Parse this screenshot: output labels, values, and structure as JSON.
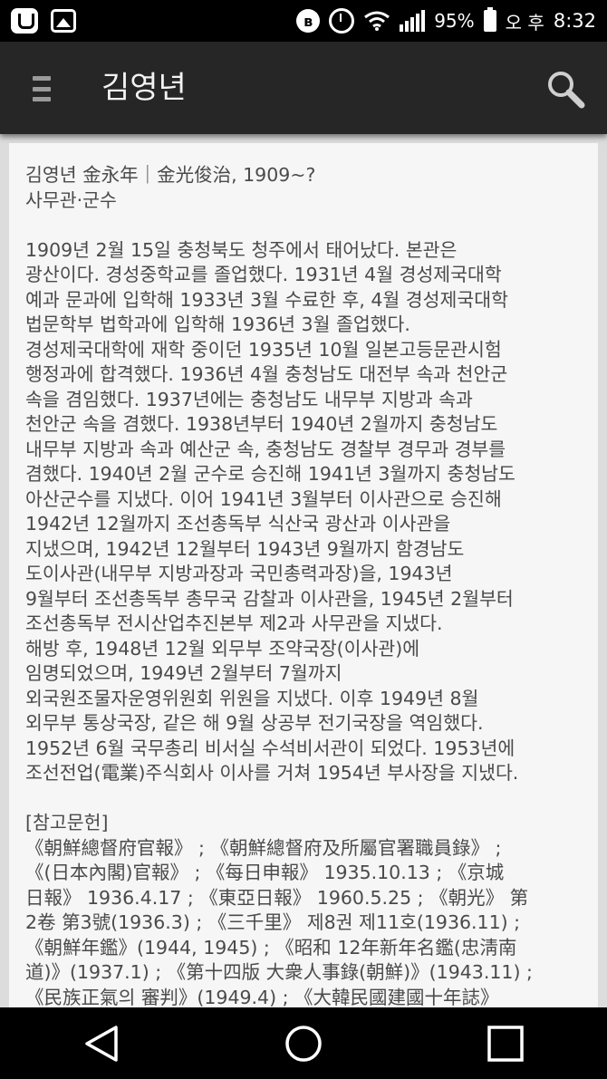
{
  "status_bar": {
    "battery": "95%",
    "ampm": "오 후",
    "time": "8:32",
    "icons": [
      "app-icon",
      "gallery-icon",
      "bluetooth-icon",
      "alarm-icon",
      "wifi-icon",
      "signal-icon",
      "battery-icon"
    ]
  },
  "appbar": {
    "title": "김영년",
    "menu_icon": "hamburger-menu-icon",
    "search_icon": "search-icon"
  },
  "article": {
    "heading_line1": "김영년 金永年｜金光俊治, 1909~?",
    "heading_line2": "사무관·군수",
    "lines": [
      "1909년 2월 15일 충청북도 청주에서 태어났다. 본관은",
      "광산이다. 경성중학교를 졸업했다. 1931년 4월 경성제국대학",
      "예과 문과에 입학해 1933년 3월 수료한 후, 4월 경성제국대학",
      "법문학부 법학과에 입학해 1936년 3월 졸업했다.",
      "경성제국대학에 재학 중이던 1935년 10월 일본고등문관시험",
      "행정과에 합격했다. 1936년 4월 충청남도 대전부 속과 천안군",
      "속을 겸임했다. 1937년에는 충청남도 내무부 지방과 속과",
      "천안군 속을 겸했다. 1938년부터 1940년 2월까지 충청남도",
      "내무부 지방과 속과 예산군 속, 충청남도 경찰부 경무과 경부를",
      "겸했다. 1940년 2월 군수로 승진해 1941년 3월까지 충청남도",
      "아산군수를 지냈다. 이어 1941년 3월부터 이사관으로 승진해",
      "1942년 12월까지 조선총독부 식산국 광산과 이사관을",
      "지냈으며, 1942년 12월부터 1943년 9월까지 함경남도",
      "도이사관(내무부 지방과장과 국민총력과장)을, 1943년",
      "9월부터 조선총독부 총무국 감찰과 이사관을, 1945년 2월부터",
      "조선총독부 전시산업추진본부 제2과 사무관을 지냈다.",
      "해방 후, 1948년 12월 외무부 조약국장(이사관)에",
      "임명되었으며, 1949년 2월부터 7월까지",
      "외국원조물자운영위원회 위원을 지냈다. 이후 1949년 8월",
      "외무부 통상국장, 같은 해 9월 상공부 전기국장을 역임했다.",
      "1952년 6월 국무총리 비서실 수석비서관이 되었다. 1953년에",
      "조선전업(電業)주식회사 이사를 거쳐 1954년 부사장을 지냈다."
    ],
    "references_title": "[참고문헌]",
    "references": [
      "《朝鮮總督府官報》 ; 《朝鮮總督府及所屬官署職員錄》 ;",
      "《(日本內閣)官報》 ; 《每日申報》 1935.10.13 ; 《京城",
      "日報》 1936.4.17 ; 《東亞日報》 1960.5.25 ; 《朝光》 第",
      "2卷 第3號(1936.3) ; 《三千里》 제8권 제11호(1936.11) ;",
      "《朝鮮年鑑》(1944, 1945) ; 《昭和 12年新年名鑑(忠淸南",
      "道)》(1937.1) ; 《第十四版 大衆人事錄(朝鮮)》(1943.11) ;",
      "《民族正氣의 審判》(1949.4) ; 《大韓民國建國十年誌》"
    ]
  },
  "navbar": {
    "back_icon": "back-triangle-icon",
    "home_icon": "home-circle-icon",
    "recents_icon": "recents-square-icon"
  }
}
